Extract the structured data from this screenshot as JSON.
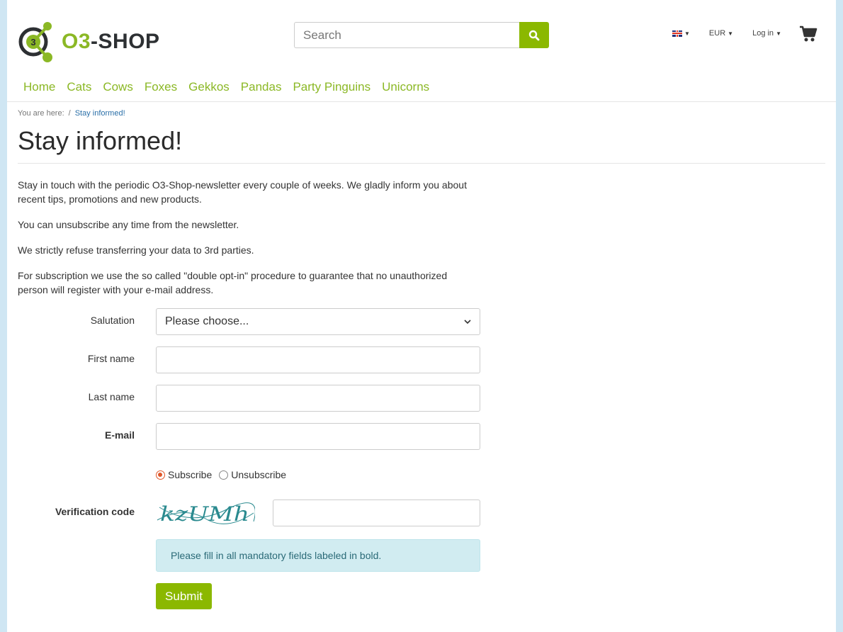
{
  "header": {
    "logo_text_o3": "O3",
    "logo_text_shop": "-SHOP",
    "search_placeholder": "Search",
    "currency": "EUR",
    "login": "Log in"
  },
  "nav": [
    "Home",
    "Cats",
    "Cows",
    "Foxes",
    "Gekkos",
    "Pandas",
    "Party Pinguins",
    "Unicorns"
  ],
  "breadcrumb": {
    "prefix": "You are here:",
    "separator": "/",
    "current": "Stay informed!"
  },
  "page_title": "Stay informed!",
  "intro": [
    "Stay in touch with the periodic O3-Shop-newsletter every couple of weeks. We gladly inform you about recent tips, promotions and new products.",
    "You can unsubscribe any time from the newsletter.",
    "We strictly refuse transferring your data to 3rd parties.",
    "For subscription we use the so called \"double opt-in\" procedure to guarantee that no unauthorized person will register with your e-mail address."
  ],
  "form": {
    "salutation_label": "Salutation",
    "salutation_value": "Please choose...",
    "first_name_label": "First name",
    "last_name_label": "Last name",
    "email_label": "E-mail",
    "subscribe_label": "Subscribe",
    "unsubscribe_label": "Unsubscribe",
    "subscribe_selected": true,
    "verification_label": "Verification code",
    "captcha_text": "kzUMh",
    "notice": "Please fill in all mandatory fields labeled in bold.",
    "submit_label": "Submit"
  },
  "colors": {
    "accent": "#8bb800",
    "link": "#2a6fa8",
    "alert_bg": "#d1ecf1"
  }
}
